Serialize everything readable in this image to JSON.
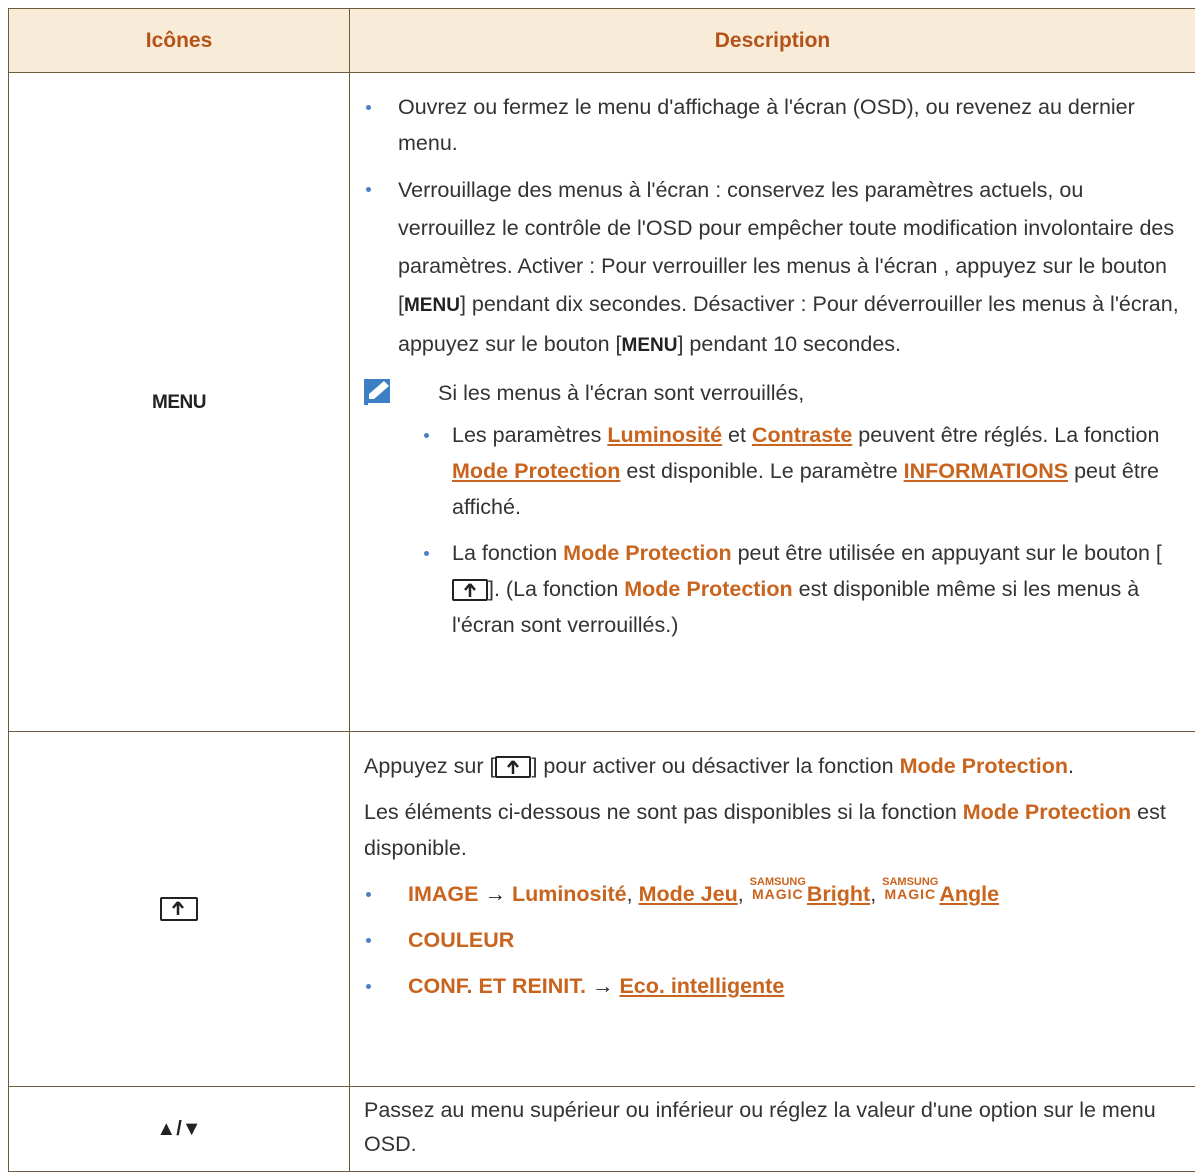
{
  "header": {
    "col_icons": "Icônes",
    "col_description": "Description"
  },
  "row_menu": {
    "icon_label": "MENU",
    "bullet1": "Ouvrez ou fermez le menu d'affichage à l'écran (OSD), ou revenez au dernier menu.",
    "bullet2_a": "Verrouillage des menus à l'écran : conservez les paramètres actuels, ou verrouillez le contrôle de l'OSD pour empêcher toute modification involontaire des paramètres. Activer : Pour verrouiller les menus à l'écran , appuyez sur le bouton [",
    "bullet2_key1": "MENU",
    "bullet2_b": "] pendant dix secondes. Désactiver : Pour déverrouiller les menus à l'écran, appuyez sur le bouton [",
    "bullet2_key2": "MENU",
    "bullet2_c": "] pendant 10 secondes.",
    "note_intro": "Si les menus à l'écran sont verrouillés,",
    "note_item1": {
      "t1": "Les paramètres ",
      "l1": "Luminosité",
      "t2": " et ",
      "l2": "Contraste",
      "t3": " peuvent être réglés. La fonction ",
      "l3": "Mode Protection",
      "t4": " est disponible. Le paramètre ",
      "l4": "INFORMATIONS",
      "t5": " peut être affiché."
    },
    "note_item2": {
      "t1": "La fonction ",
      "b1": "Mode Protection",
      "t2": " peut être utilisée en appuyant sur le bouton [",
      "t3": "]. (La fonction ",
      "b2": "Mode Protection",
      "t4": " est disponible même si les menus à l'écran sont verrouillés.)"
    }
  },
  "row_protect": {
    "icon_name": "source-arrow-up-icon",
    "p1_a": "Appuyez sur [",
    "p1_b": "] pour activer ou désactiver la fonction ",
    "p1_hl": "Mode Protection",
    "p1_c": ".",
    "p2_a": "Les éléments ci-dessous ne sont pas disponibles si la fonction ",
    "p2_hl": "Mode Protection",
    "p2_b": " est disponible.",
    "li1": {
      "a": "IMAGE",
      "arrow": " → ",
      "b": "Luminosité",
      "sep1": ", ",
      "c": "Mode Jeu",
      "sep2": ", ",
      "magic_top": "SAMSUNG",
      "magic_bottom": "MAGIC",
      "d": "Bright",
      "sep3": ", ",
      "e": "Angle"
    },
    "li2": "COULEUR",
    "li3": {
      "a": "CONF. ET REINIT.",
      "arrow": " → ",
      "b": "Eco. intelligente"
    }
  },
  "row_arrows": {
    "icon_label": "▲/▼",
    "text": "Passez au menu supérieur ou inférieur ou réglez la valeur d'une option sur le menu OSD."
  }
}
